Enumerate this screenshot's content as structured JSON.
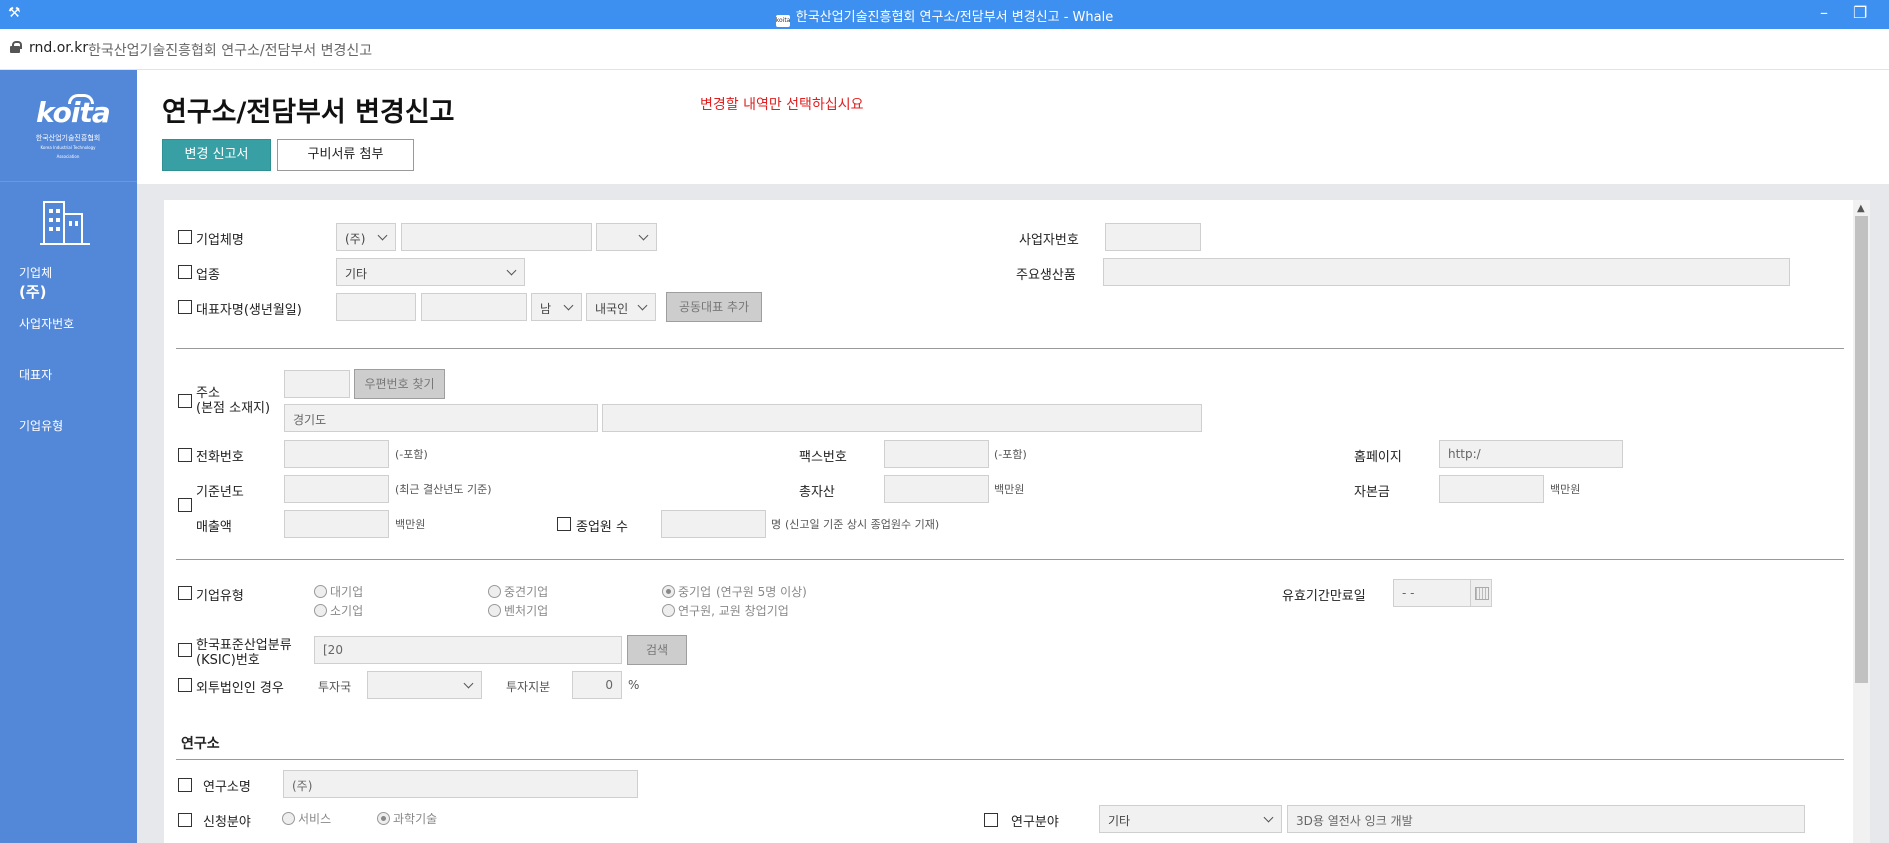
{
  "browser": {
    "window_title": "한국산업기술진흥협회 연구소/전담부서 변경신고 - Whale",
    "favicon_text": "koita",
    "url": "rnd.or.kr",
    "page_title": "한국산업기술진흥협회 연구소/전담부서 변경신고"
  },
  "icons": {
    "pin": "pin-icon",
    "minimize": "minimize-icon",
    "restore": "restore-icon",
    "lock": "lock-icon",
    "building": "building-icon",
    "calendar": "calendar-icon",
    "chevron": "chevron-down-icon"
  },
  "colors": {
    "titlebar": "#3d8ff0",
    "sidebar": "#5387d8",
    "accent": "#38a0a4",
    "notice": "#e02020"
  },
  "sidebar": {
    "logo_text": "koita",
    "logo_sub": "한국산업기술진흥협회",
    "logo_sub2": "Korea Industrial Technology Association",
    "company_type_label": "기업체",
    "company_type_value": "(주)",
    "items": [
      "사업자번호",
      "대표자",
      "기업유형"
    ]
  },
  "header": {
    "title": "연구소/전담부서 변경신고",
    "notice": "변경할 내역만 선택하십시요",
    "tabs": [
      "변경 신고서",
      "구비서류 첨부"
    ]
  },
  "form": {
    "company_name": {
      "label": "기업체명",
      "prefix_select": "(주)",
      "name_value": "",
      "suffix_select": ""
    },
    "business_number": {
      "label": "사업자번호",
      "value": ""
    },
    "industry": {
      "label": "업종",
      "select": "기타"
    },
    "main_product": {
      "label": "주요생산품",
      "value": ""
    },
    "representative": {
      "label": "대표자명(생년월일)",
      "gender_select": "남",
      "nationality_select": "내국인",
      "add_button": "공동대표 추가"
    },
    "address": {
      "label1": "주소",
      "label2": "(본점 소재지)",
      "postcode_button": "우편번호 찾기",
      "province": "경기도",
      "detail": ""
    },
    "phone": {
      "label": "전화번호",
      "hint": "(-포함)"
    },
    "fax": {
      "label": "팩스번호",
      "hint": "(-포함)"
    },
    "homepage": {
      "label": "홈페이지",
      "value": "http:/"
    },
    "base_year": {
      "label": "기준년도",
      "hint": "(최근 결산년도 기준)"
    },
    "total_assets": {
      "label": "총자산",
      "unit": "백만원"
    },
    "capital": {
      "label": "자본금",
      "unit": "백만원"
    },
    "sales": {
      "label": "매출액",
      "unit": "백만원"
    },
    "employees": {
      "label": "종업원 수",
      "unit": "명",
      "hint": "(신고일 기준 상시 종업원수 기재)"
    },
    "company_type": {
      "label": "기업유형",
      "options": [
        "대기업",
        "중견기업",
        "중기업",
        "소기업",
        "벤처기업",
        "연구원, 교원 창업기업"
      ],
      "selected": "중기업",
      "selected_note": "(연구원 5명 이상)"
    },
    "expiry": {
      "label": "유효기간만료일",
      "value": "- -"
    },
    "ksic": {
      "label1": "한국표준산업분류",
      "label2": "(KSIC)번호",
      "value": "[20",
      "search_button": "검색"
    },
    "foreign": {
      "label": "외투법인인 경우",
      "country_label": "투자국",
      "country_select": "",
      "share_label": "투자지분",
      "share_value": "0",
      "share_unit": "%"
    },
    "lab_section": {
      "heading": "연구소"
    },
    "lab_name": {
      "label": "연구소명",
      "value": "(주)"
    },
    "apply_field": {
      "label": "신청분야",
      "options": [
        "서비스",
        "과학기술"
      ],
      "selected": "과학기술"
    },
    "research_field": {
      "label": "연구분야",
      "select": "기타",
      "value": "3D용 열전사 잉크 개발"
    }
  }
}
